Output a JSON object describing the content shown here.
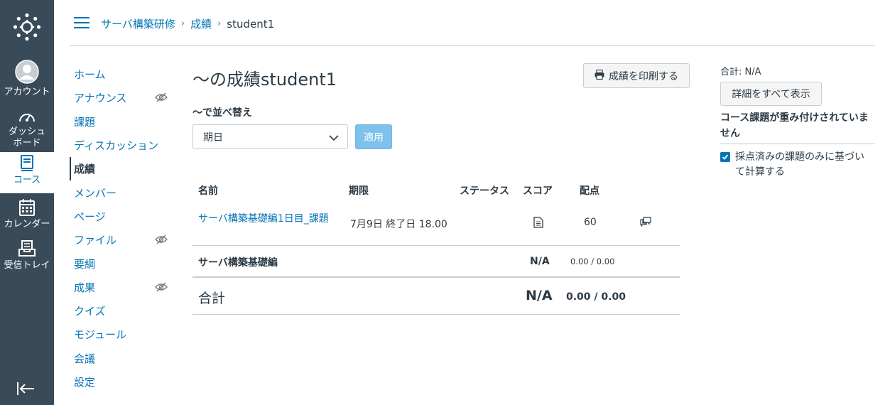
{
  "global_nav": {
    "account": "アカウント",
    "dashboard_line1": "ダッシュ",
    "dashboard_line2": "ボード",
    "courses": "コース",
    "calendar": "カレンダー",
    "inbox": "受信トレイ"
  },
  "breadcrumb": {
    "course": "サーバ構築研修",
    "grades": "成績",
    "student": "student1"
  },
  "course_nav": [
    {
      "label": "ホーム",
      "hidden": false
    },
    {
      "label": "アナウンス",
      "hidden": true
    },
    {
      "label": "課題",
      "hidden": false
    },
    {
      "label": "ディスカッション",
      "hidden": false
    },
    {
      "label": "成績",
      "hidden": false,
      "active": true
    },
    {
      "label": "メンバー",
      "hidden": false
    },
    {
      "label": "ページ",
      "hidden": false
    },
    {
      "label": "ファイル",
      "hidden": true
    },
    {
      "label": "要綱",
      "hidden": false
    },
    {
      "label": "成果",
      "hidden": true
    },
    {
      "label": "クイズ",
      "hidden": false
    },
    {
      "label": "モジュール",
      "hidden": false
    },
    {
      "label": "会議",
      "hidden": false
    },
    {
      "label": "設定",
      "hidden": false
    }
  ],
  "main": {
    "title": "〜の成績student1",
    "print_label": "成績を印刷する",
    "sort_label": "〜で並べ替え",
    "sort_value": "期日",
    "apply_label": "適用"
  },
  "table": {
    "headers": {
      "name": "名前",
      "due": "期限",
      "status": "ステータス",
      "score": "スコア",
      "points": "配点"
    },
    "row": {
      "name": "サーバ構築基礎編1日目_課題",
      "due": "7月9日 終了日 18.00",
      "points": "60"
    },
    "group": {
      "name": "サーバ構築基礎編",
      "score": "N/A",
      "points": "0.00 / 0.00"
    },
    "total": {
      "name": "合計",
      "score": "N/A",
      "points": "0.00 / 0.00"
    }
  },
  "sidebar": {
    "total": "合計: N/A",
    "show_all": "詳細をすべて表示",
    "weight_note": "コース課題が重み付けされていません",
    "checkbox_label": "採点済みの課題のみに基づいて計算する",
    "checkbox_checked": true
  },
  "colors": {
    "nav_bg": "#394b58",
    "link": "#0374b5",
    "apply_bg": "#7ec1ec"
  }
}
